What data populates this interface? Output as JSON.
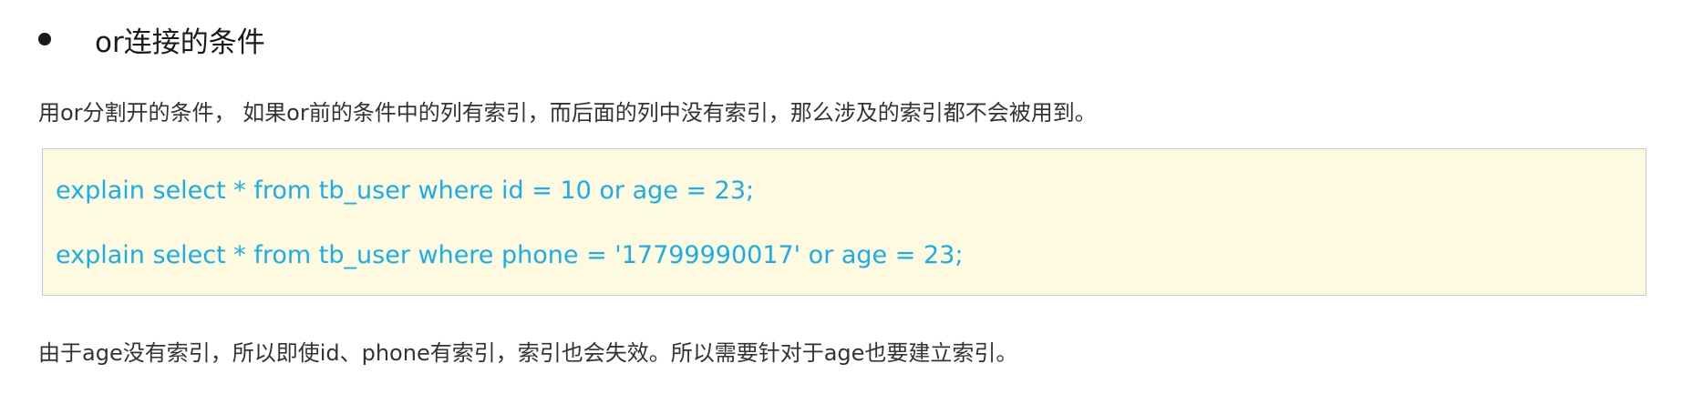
{
  "heading": "or连接的条件",
  "paragraph_intro": "用or分割开的条件， 如果or前的条件中的列有索引，而后面的列中没有索引，那么涉及的索引都不会被用到。",
  "code_block": {
    "lines": [
      "explain select * from tb_user where id = 10 or age = 23;",
      "explain select * from tb_user where phone = '17799990017' or age = 23;"
    ]
  },
  "paragraph_conclusion": "由于age没有索引，所以即使id、phone有索引，索引也会失效。所以需要针对于age也要建立索引。",
  "colors": {
    "code_text": "#1aaee6",
    "code_background": "#fefae0",
    "code_border": "#c9c9c9"
  }
}
